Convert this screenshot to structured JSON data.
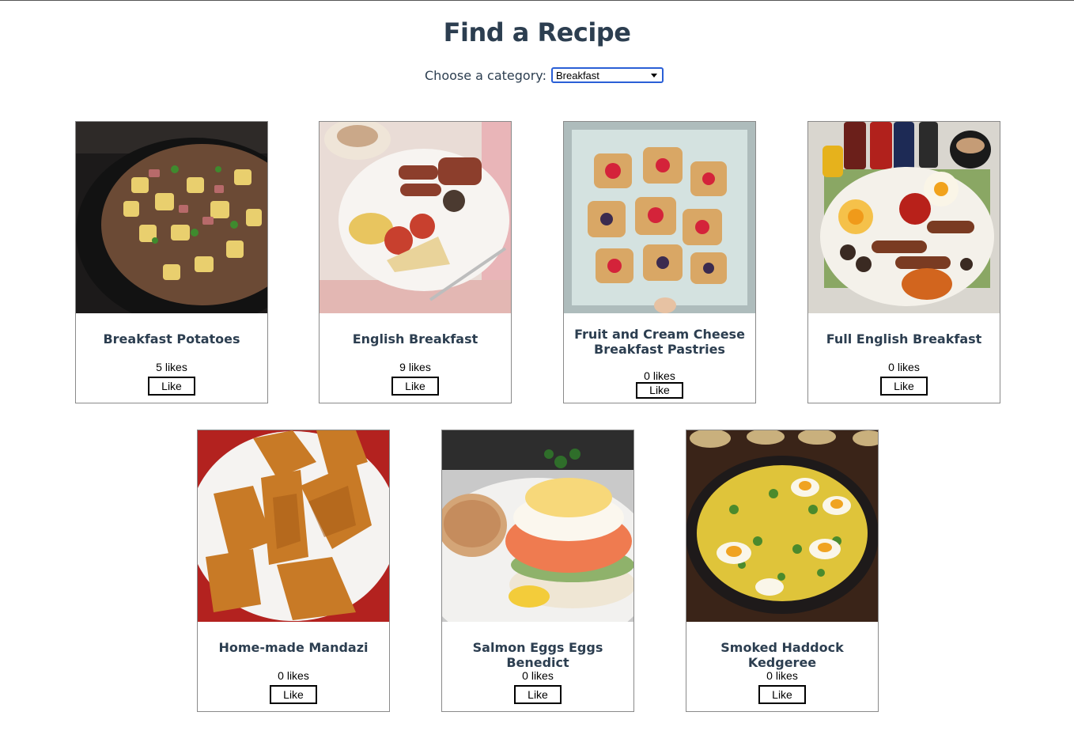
{
  "page": {
    "title": "Find a Recipe"
  },
  "filter": {
    "label": "Choose a category:",
    "selected": "Breakfast"
  },
  "recipes": [
    {
      "name": "Breakfast Potatoes",
      "likes": "5 likes",
      "button": "Like"
    },
    {
      "name": "English Breakfast",
      "likes": "9 likes",
      "button": "Like"
    },
    {
      "name": "Fruit and Cream Cheese Breakfast Pastries",
      "likes": "0 likes",
      "button": "Like"
    },
    {
      "name": "Full English Breakfast",
      "likes": "0 likes",
      "button": "Like"
    },
    {
      "name": "Home-made Mandazi",
      "likes": "0 likes",
      "button": "Like"
    },
    {
      "name": "Salmon Eggs Eggs Benedict",
      "likes": "0 likes",
      "button": "Like"
    },
    {
      "name": "Smoked Haddock Kedgeree",
      "likes": "0 likes",
      "button": "Like"
    }
  ]
}
